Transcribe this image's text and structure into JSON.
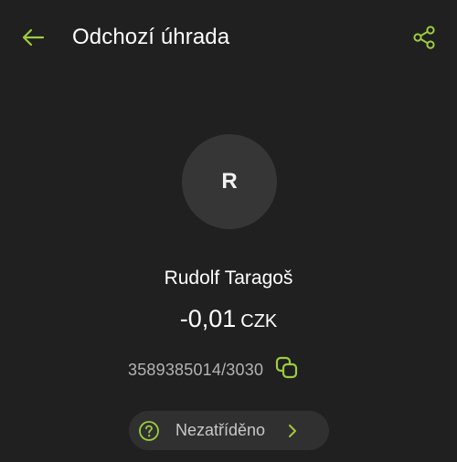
{
  "appbar": {
    "title": "Odchozí úhrada",
    "back_icon": "arrow-left-icon",
    "share_icon": "share-icon"
  },
  "counterparty": {
    "avatar_initial": "R",
    "name": "Rudolf Taragoš"
  },
  "transaction": {
    "amount": "-0,01",
    "currency": "CZK",
    "account_number": "3589385014/3030",
    "copy_icon": "copy-icon"
  },
  "category": {
    "label": "Nezatříděno",
    "icon": "question-circle-icon",
    "chevron_icon": "chevron-right-icon"
  },
  "colors": {
    "background": "#202020",
    "accent": "#9ccc3f",
    "avatar_bg": "#363636",
    "chip_bg": "#303030",
    "secondary_text": "#b3b3b3"
  }
}
